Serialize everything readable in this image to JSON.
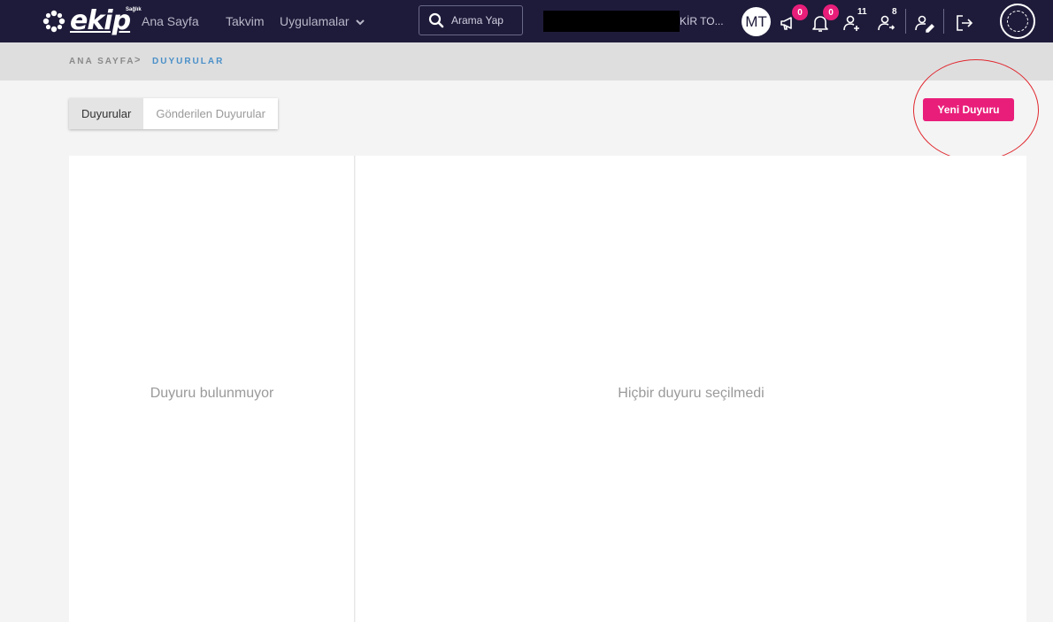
{
  "app": {
    "logo_text": "ekip",
    "logo_small": "Sağlık"
  },
  "nav": {
    "home": "Ana Sayfa",
    "calendar": "Takvim",
    "apps": "Uygulamalar"
  },
  "search": {
    "placeholder": "Arama Yap"
  },
  "user": {
    "name_fragment": "KİR TO...",
    "initials": "MT"
  },
  "badges": {
    "announcements": "0",
    "notifications": "0",
    "user_add": "11",
    "user_share": "8"
  },
  "breadcrumb": {
    "home": "ANA SAYFA",
    "separator": ">",
    "current": "DUYURULAR"
  },
  "tabs": [
    {
      "label": "Duyurular",
      "active": true
    },
    {
      "label": "Gönderilen Duyurular",
      "active": false
    }
  ],
  "actions": {
    "new_announcement": "Yeni Duyuru"
  },
  "panels": {
    "list_empty": "Duyuru bulunmuyor",
    "detail_empty": "Hiçbir duyuru seçilmedi"
  },
  "colors": {
    "navbar": "#1e1b3a",
    "accent": "#e91e7a",
    "breadcrumb_current": "#4a90c8"
  },
  "icons": [
    "megaphone-icon",
    "bell-icon",
    "user-add-icon",
    "user-share-icon",
    "user-edit-icon",
    "logout-icon",
    "ministry-emblem-icon"
  ]
}
